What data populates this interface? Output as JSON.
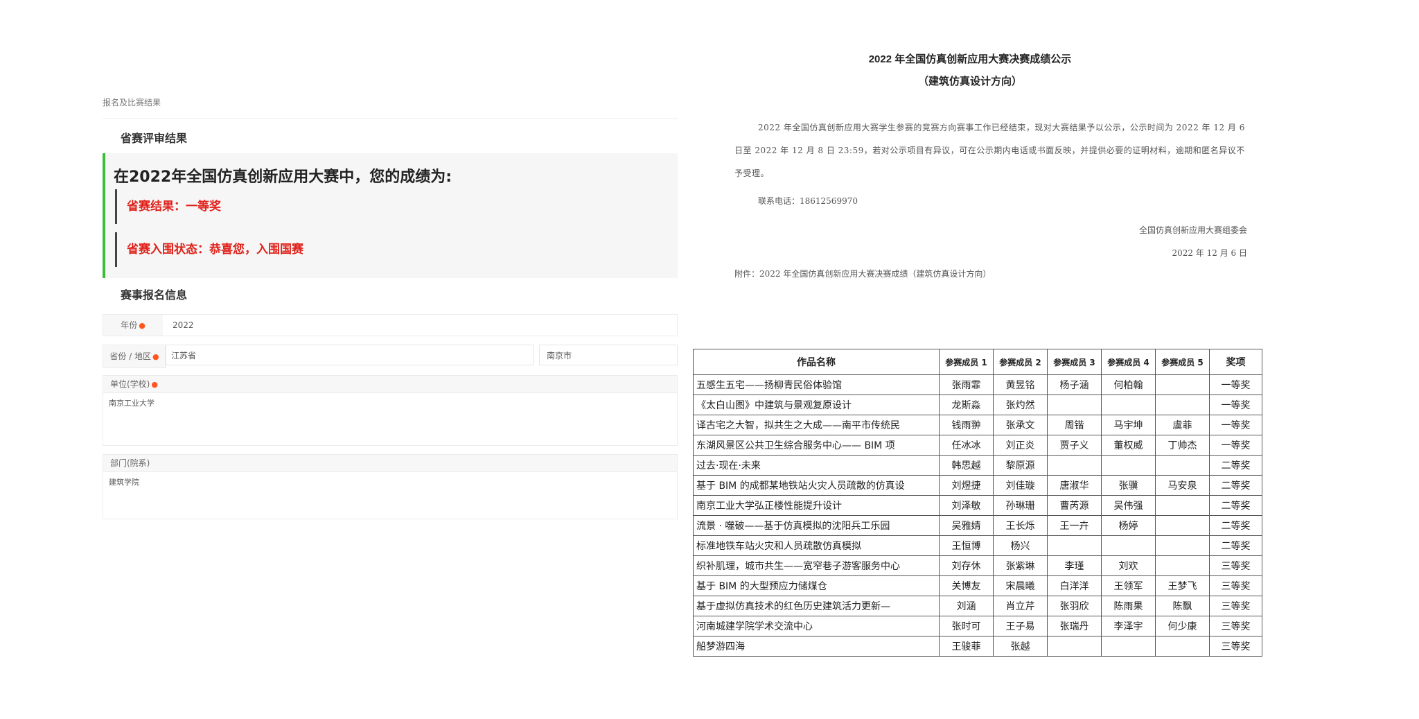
{
  "left": {
    "breadcrumb": "报名及比赛结果",
    "review_title": "省赛评审结果",
    "result_heading": "在2022年全国仿真创新应用大赛中，您的成绩为:",
    "result_line1": "省赛结果：一等奖",
    "result_line2": "省赛入围状态：恭喜您，入围国赛",
    "info_title": "赛事报名信息",
    "year_label": "年份",
    "year_value": "2022",
    "province_label": "省份 / 地区",
    "province_value": "江苏省",
    "city_value": "南京市",
    "unit_label": "单位(学校)",
    "unit_value": "南京工业大学",
    "dept_label": "部门(院系)",
    "dept_value": "建筑学院"
  },
  "right": {
    "title1": "2022 年全国仿真创新应用大赛决赛成绩公示",
    "title2": "（建筑仿真设计方向）",
    "paragraph": "2022 年全国仿真创新应用大赛学生参赛的竞赛方向赛事工作已经结束，现对大赛结果予以公示，公示时间为 2022 年 12 月 6 日至 2022 年 12 月 8 日 23:59，若对公示项目有异议，可在公示期内电话或书面反映，并提供必要的证明材料，逾期和匿名异议不予受理。",
    "contact": "联系电话：18612569970",
    "org": "全国仿真创新应用大赛组委会",
    "date": "2022 年 12 月 6 日",
    "attachment": "附件：2022 年全国仿真创新应用大赛决赛成绩（建筑仿真设计方向）"
  },
  "table": {
    "headers": [
      "作品名称",
      "参赛成员 1",
      "参赛成员 2",
      "参赛成员 3",
      "参赛成员 4",
      "参赛成员 5",
      "奖项"
    ],
    "rows": [
      [
        "五感生五宅——扬柳青民俗体验馆",
        "张雨霏",
        "黄昱铭",
        "杨子涵",
        "何柏翰",
        "",
        "一等奖"
      ],
      [
        "《太白山图》中建筑与景观复原设计",
        "龙斯淼",
        "张灼然",
        "",
        "",
        "",
        "一等奖"
      ],
      [
        "译古宅之大智，拟共生之大成——南平市传统民",
        "钱雨翀",
        "张承文",
        "周锴",
        "马宇坤",
        "虞菲",
        "一等奖"
      ],
      [
        "东湖风景区公共卫生综合服务中心—— BIM 项",
        "任冰冰",
        "刘正炎",
        "贾子义",
        "董权威",
        "丁帅杰",
        "一等奖"
      ],
      [
        "过去·现在·未来",
        "韩思越",
        "黎原源",
        "",
        "",
        "",
        "二等奖"
      ],
      [
        "基于 BIM 的成都某地铁站火灾人员疏散的仿真设",
        "刘煜捷",
        "刘佳璇",
        "唐淑华",
        "张骥",
        "马安泉",
        "二等奖"
      ],
      [
        "南京工业大学弘正楼性能提升设计",
        "刘泽敏",
        "孙琳珊",
        "曹芮源",
        "吴伟强",
        "",
        "二等奖"
      ],
      [
        "流景 · 噬破——基于仿真模拟的沈阳兵工乐园",
        "吴雅婧",
        "王长烁",
        "王一卉",
        "杨婷",
        "",
        "二等奖"
      ],
      [
        "标准地铁车站火灾和人员疏散仿真模拟",
        "王恒博",
        "杨兴",
        "",
        "",
        "",
        "二等奖"
      ],
      [
        "织补肌理，城市共生——宽窄巷子游客服务中心",
        "刘存休",
        "张紫琳",
        "李瑾",
        "刘欢",
        "",
        "三等奖"
      ],
      [
        "基于 BIM 的大型预应力储煤仓",
        "关博友",
        "宋晨曦",
        "白洋洋",
        "王领军",
        "王梦飞",
        "三等奖"
      ],
      [
        "基于虚拟仿真技术的红色历史建筑活力更新—",
        "刘涵",
        "肖立芹",
        "张羽欣",
        "陈雨果",
        "陈飘",
        "三等奖"
      ],
      [
        "河南城建学院学术交流中心",
        "张时可",
        "王子易",
        "张瑞丹",
        "李泽宇",
        "何少康",
        "三等奖"
      ],
      [
        "船梦游四海",
        "王骏菲",
        "张越",
        "",
        "",
        "",
        "三等奖"
      ]
    ]
  },
  "colors": {
    "accent_bar": "#3cbc3c",
    "result_text": "#e0231c",
    "required_dot": "#ff5722"
  }
}
